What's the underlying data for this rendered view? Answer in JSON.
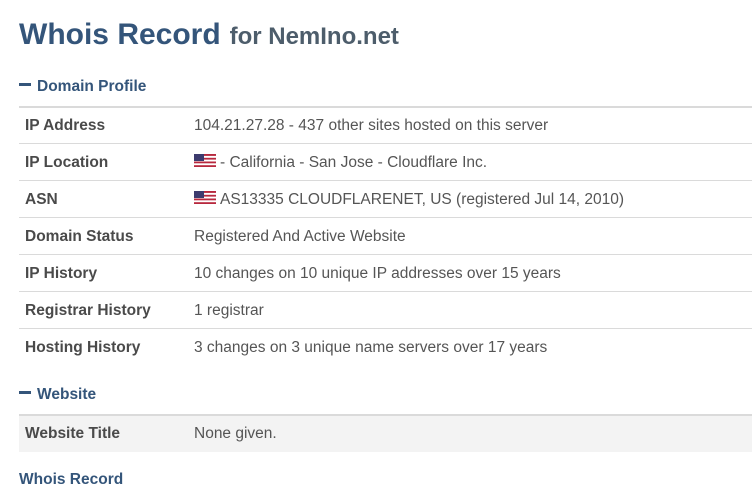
{
  "header": {
    "title": "Whois Record",
    "subtitle": "for NemIno.net"
  },
  "domain_profile": {
    "heading": "Domain Profile",
    "rows": [
      {
        "label": "IP Address",
        "value": "104.21.27.28 - 437 other sites hosted on this server"
      },
      {
        "label": "IP Location",
        "value": "- California - San Jose - Cloudflare Inc.",
        "flag": "us-flag-icon"
      },
      {
        "label": "ASN",
        "value": "AS13335 CLOUDFLARENET, US (registered Jul 14, 2010)",
        "flag": "us-flag-icon"
      },
      {
        "label": "Domain Status",
        "value": "Registered And Active Website"
      },
      {
        "label": "IP History",
        "value": "10 changes on 10 unique IP addresses over 15 years"
      },
      {
        "label": "Registrar History",
        "value": "1 registrar"
      },
      {
        "label": "Hosting History",
        "value": "3 changes on 3 unique name servers over 17 years"
      }
    ]
  },
  "website": {
    "heading": "Website",
    "rows": [
      {
        "label": "Website Title",
        "value": "None given."
      }
    ]
  },
  "whois_record": {
    "heading": "Whois Record"
  },
  "colors": {
    "heading": "#34557a",
    "subtitle": "#4d5d6b",
    "divider": "#dadada",
    "shaded_row": "#f3f3f3"
  }
}
